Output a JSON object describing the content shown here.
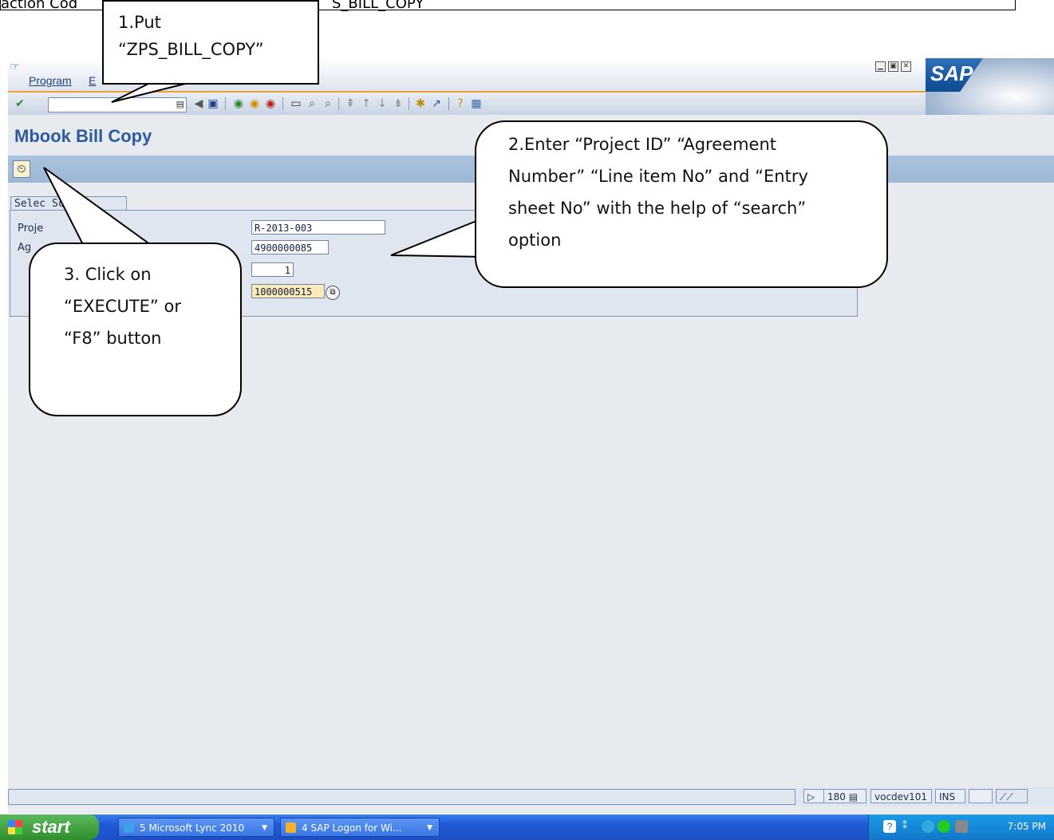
{
  "doc_strip": {
    "left_text": "action Cod",
    "right_text": "S_BILL_COPY"
  },
  "menu": {
    "items": [
      "Program",
      "E"
    ]
  },
  "window_controls": [
    "▁",
    "▣",
    "✕"
  ],
  "sap_logo": "SAP",
  "page_title": "Mbook Bill Copy",
  "selection": {
    "tab_label": "Selec Screen",
    "labels": [
      "Proje",
      "Ag",
      "",
      ""
    ],
    "fields": [
      "R-2013-003",
      "4900000085",
      "1",
      "1000000515"
    ]
  },
  "status": {
    "count": "180",
    "system": "vocdev101",
    "mode": "INS"
  },
  "taskbar": {
    "start": "start",
    "tasks": [
      "5 Microsoft Lync 2010",
      "4 SAP Logon for Wi..."
    ],
    "clock": "7:05 PM"
  },
  "callouts": {
    "c1": [
      "1.Put",
      "“ZPS_BILL_COPY”"
    ],
    "c2": [
      "2.Enter “Project ID” “Agreement",
      "Number” “Line item No” and “Entry",
      "sheet No” with the help of “search”",
      "option"
    ],
    "c3": [
      "3. Click on",
      "“EXECUTE” or",
      "“F8” button"
    ]
  }
}
